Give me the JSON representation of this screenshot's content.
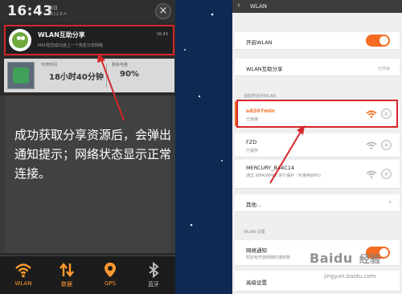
{
  "notification_shade": {
    "clock": "16:43",
    "weekday": "周日",
    "date": "2012.8.4",
    "close_symbol": "×",
    "notification": {
      "title": "WLAN互助分享",
      "time": "16:43",
      "body": "MIUI替您成功连上一个热爱分享网络",
      "icon": "android-icon"
    },
    "stats": {
      "time_label": "可用时间",
      "time_value": "18小时40分钟",
      "battery_label": "剩余电量",
      "battery_value": "90%"
    }
  },
  "annotation": {
    "text": "成功获取分享资源后，会弹出通知提示；网络状态显示正常连接。"
  },
  "dock": {
    "items": [
      {
        "label": "WLAN",
        "icon": "wifi-icon"
      },
      {
        "label": "数据",
        "icon": "data-arrows-icon"
      },
      {
        "label": "GPS",
        "icon": "gps-icon"
      },
      {
        "label": "蓝牙",
        "icon": "bluetooth-icon"
      }
    ]
  },
  "wlan_settings": {
    "back_symbol": "‹",
    "title": "WLAN",
    "enable_label": "开启WLAN",
    "mutual_share_label": "WLAN互助分享",
    "mutual_share_status": "已开启",
    "networks_section": "选取附近的WLAN",
    "networks": [
      {
        "ssid": "sd207mln",
        "status": "已连接"
      },
      {
        "ssid": "FZD",
        "status": "已保存"
      },
      {
        "ssid": "MERCURY_B44C14",
        "status": "通过 WPA/WPA2 进行保护（可使用WPS）"
      }
    ],
    "other_label": "其他...",
    "settings_section": "WLAN 设置",
    "notify_label": "网络通知",
    "notify_desc": "附近有开放网络时通知我",
    "advanced_label": "高级设置"
  },
  "watermark": {
    "brand": "Baidu",
    "cn": "经验",
    "url": "jingyan.baidu.com"
  },
  "colors": {
    "accent_orange": "#f36c21",
    "highlight_red": "#d5262a",
    "dock_active": "#ff9a2e",
    "background_navy": "#0e2a52"
  }
}
